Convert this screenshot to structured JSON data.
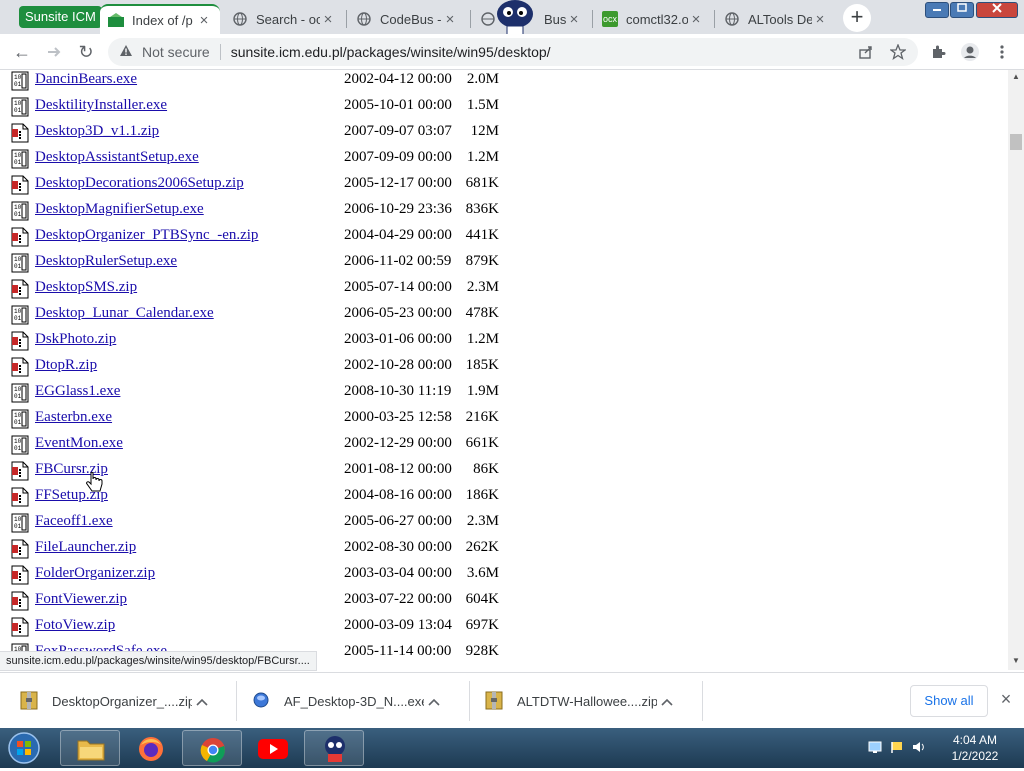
{
  "tab_group": "Sunsite ICM",
  "tabs": [
    {
      "title": "Index of /p",
      "active": true
    },
    {
      "title": "Search - oc",
      "active": false
    },
    {
      "title": "CodeBus -",
      "active": false
    },
    {
      "title": "Bus |",
      "active": false
    },
    {
      "title": "comctl32.o",
      "active": false
    },
    {
      "title": "ALTools De",
      "active": false
    }
  ],
  "tab_close_glyph": "×",
  "new_tab_glyph": "+",
  "toolbar": {
    "back_glyph": "←",
    "reload_glyph": "↻",
    "security_label": "Not secure",
    "url": "sunsite.icm.edu.pl/packages/winsite/win95/desktop/"
  },
  "listing": [
    {
      "name": "DancinBears.exe",
      "date": "2002-04-12 00:00",
      "size": "2.0M",
      "type": "exe"
    },
    {
      "name": "DesktilityInstaller.exe",
      "date": "2005-10-01 00:00",
      "size": "1.5M",
      "type": "exe"
    },
    {
      "name": "Desktop3D_v1.1.zip",
      "date": "2007-09-07 03:07",
      "size": "12M",
      "type": "zip"
    },
    {
      "name": "DesktopAssistantSetup.exe",
      "date": "2007-09-09 00:00",
      "size": "1.2M",
      "type": "exe"
    },
    {
      "name": "DesktopDecorations2006Setup.zip",
      "date": "2005-12-17 00:00",
      "size": "681K",
      "type": "zip"
    },
    {
      "name": "DesktopMagnifierSetup.exe",
      "date": "2006-10-29 23:36",
      "size": "836K",
      "type": "exe"
    },
    {
      "name": "DesktopOrganizer_PTBSync_-en.zip",
      "date": "2004-04-29 00:00",
      "size": "441K",
      "type": "zip"
    },
    {
      "name": "DesktopRulerSetup.exe",
      "date": "2006-11-02 00:59",
      "size": "879K",
      "type": "exe"
    },
    {
      "name": "DesktopSMS.zip",
      "date": "2005-07-14 00:00",
      "size": "2.3M",
      "type": "zip"
    },
    {
      "name": "Desktop_Lunar_Calendar.exe",
      "date": "2006-05-23 00:00",
      "size": "478K",
      "type": "exe"
    },
    {
      "name": "DskPhoto.zip",
      "date": "2003-01-06 00:00",
      "size": "1.2M",
      "type": "zip"
    },
    {
      "name": "DtopR.zip",
      "date": "2002-10-28 00:00",
      "size": "185K",
      "type": "zip"
    },
    {
      "name": "EGGlass1.exe",
      "date": "2008-10-30 11:19",
      "size": "1.9M",
      "type": "exe"
    },
    {
      "name": "Easterbn.exe",
      "date": "2000-03-25 12:58",
      "size": "216K",
      "type": "exe"
    },
    {
      "name": "EventMon.exe",
      "date": "2002-12-29 00:00",
      "size": "661K",
      "type": "exe"
    },
    {
      "name": "FBCursr.zip",
      "date": "2001-08-12 00:00",
      "size": "86K",
      "type": "zip"
    },
    {
      "name": "FFSetup.zip",
      "date": "2004-08-16 00:00",
      "size": "186K",
      "type": "zip"
    },
    {
      "name": "Faceoff1.exe",
      "date": "2005-06-27 00:00",
      "size": "2.3M",
      "type": "exe"
    },
    {
      "name": "FileLauncher.zip",
      "date": "2002-08-30 00:00",
      "size": "262K",
      "type": "zip"
    },
    {
      "name": "FolderOrganizer.zip",
      "date": "2003-03-04 00:00",
      "size": "3.6M",
      "type": "zip"
    },
    {
      "name": "FontViewer.zip",
      "date": "2003-07-22 00:00",
      "size": "604K",
      "type": "zip"
    },
    {
      "name": "FotoView.zip",
      "date": "2000-03-09 13:04",
      "size": "697K",
      "type": "zip"
    },
    {
      "name": "FoxPasswordSafe.exe",
      "date": "2005-11-14 00:00",
      "size": "928K",
      "type": "exe"
    }
  ],
  "status_url": "sunsite.icm.edu.pl/packages/winsite/win95/desktop/FBCursr....",
  "downloads": [
    {
      "name": "DesktopOrganizer_....zip",
      "icon": "zip-file-icon"
    },
    {
      "name": "AF_Desktop-3D_N....exe",
      "icon": "exe-file-icon"
    },
    {
      "name": "ALTDTW-Hallowee....zip",
      "icon": "zip-file-icon"
    }
  ],
  "show_all_label": "Show all",
  "shelf_close_glyph": "×",
  "clock": {
    "time": "4:04 AM",
    "date": "1/2/2022"
  },
  "colors": {
    "link": "#1a0dab",
    "group": "#1e8e3e",
    "accent": "#1a73e8"
  }
}
